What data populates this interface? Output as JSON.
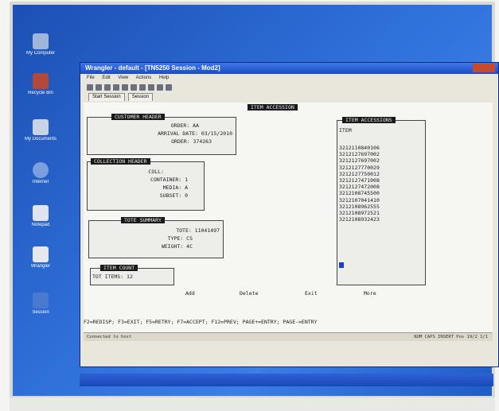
{
  "window": {
    "title": "Wrangler - default - [TN5250 Session - Mod2]",
    "menu": [
      "File",
      "Edit",
      "View",
      "Actions",
      "Help"
    ],
    "tabs": [
      "Start Session",
      "Session"
    ]
  },
  "desktop": {
    "icons": [
      "My Computer",
      "Recycle Bin",
      "My Documents",
      "Internet",
      "Notepad",
      "Wrangler",
      "Session"
    ]
  },
  "screen": {
    "title": "ITEM ACCESSION",
    "customer": {
      "header": "CUSTOMER HEADER",
      "rows": [
        "ORDER: AA",
        "ARRIVAL DATE: 03/15/2010",
        "ORDER: 374263"
      ]
    },
    "collection": {
      "header": "COLLECTION HEADER",
      "rows": [
        "COLL:",
        "CONTAINER: 1",
        "MEDIA: A",
        "SUBSET: 0"
      ]
    },
    "summary": {
      "header": "TOTE SUMMARY",
      "rows": [
        "TOTE: 11041497",
        "TYPE: CS",
        "WEIGHT: 4C"
      ]
    },
    "count": {
      "header": "ITEM COUNT",
      "row": "TOT ITEMS: 12"
    },
    "items": {
      "header": "ITEM ACCESSIONS",
      "sub": "ITEM",
      "list": [
        "3212110840106",
        "3212127697002",
        "3212127697002",
        "3212127770029",
        "3212127750012",
        "3212127471008",
        "3212127472008",
        "3212108745500",
        "3212107041410",
        "3212108962555",
        "3212108972521",
        "3212108932423"
      ]
    },
    "actions": [
      "Add",
      "Delete",
      "Exit",
      "More"
    ],
    "fkeys": "F2=REDISP; F3=EXIT; F5=RETRY; F7=ACCEPT; F12=PREV; PAGE+=ENTRY; PAGE-=ENTRY"
  },
  "statusbar": {
    "left": "Connected to host",
    "right": "NUM  CAPS  INSERT  Pos 19/2  1/1"
  }
}
